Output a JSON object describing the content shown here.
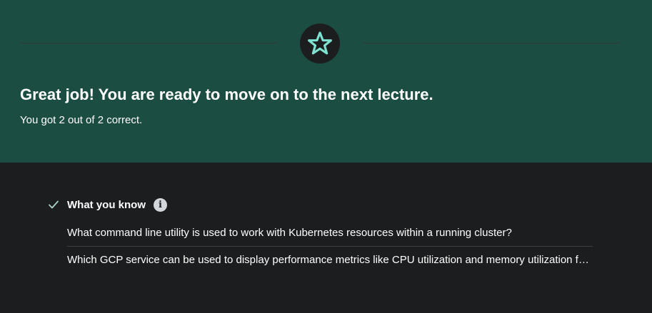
{
  "banner": {
    "icon": "star-icon",
    "accent_color": "#7de2cf",
    "headline": "Great job! You are ready to move on to the next lecture.",
    "score_text": "You got 2 out of 2 correct."
  },
  "know": {
    "check_icon": "check-icon",
    "title": "What you know",
    "info_icon": "info-icon",
    "info_glyph": "i",
    "items": [
      {
        "text": "What command line utility is used to work with Kubernetes resources within a running cluster?"
      },
      {
        "text": "Which GCP service can be used to display performance metrics like CPU utilization and memory utilization for your containers?"
      }
    ]
  }
}
